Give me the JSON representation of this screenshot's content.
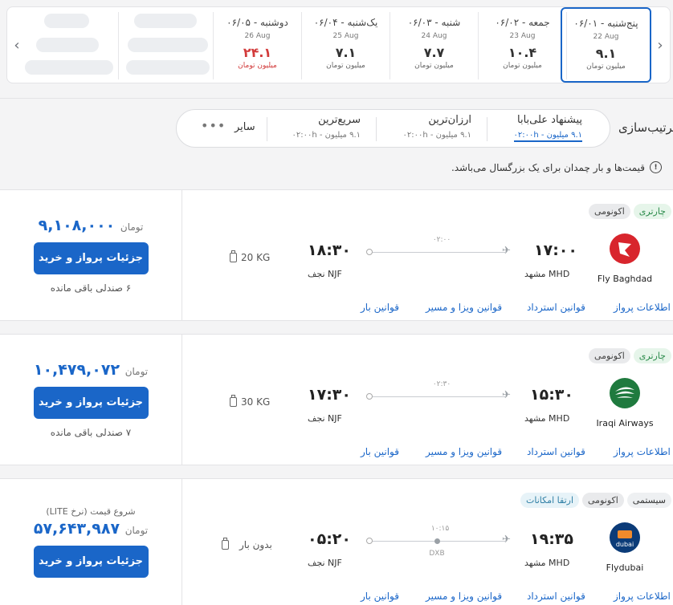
{
  "date_strip": {
    "days": [
      {
        "name": "پنج‌شنبه - ۰۶/۰۱",
        "greg": "22 Aug",
        "price": "۹.۱",
        "unit": "میلیون تومان",
        "selected": true
      },
      {
        "name": "جمعه - ۰۶/۰۲",
        "greg": "23 Aug",
        "price": "۱۰.۴",
        "unit": "میلیون تومان"
      },
      {
        "name": "شنبه - ۰۶/۰۳",
        "greg": "24 Aug",
        "price": "۷.۷",
        "unit": "میلیون تومان"
      },
      {
        "name": "یک‌شنبه - ۰۶/۰۴",
        "greg": "25 Aug",
        "price": "۷.۱",
        "unit": "میلیون تومان"
      },
      {
        "name": "دوشنبه - ۰۶/۰۵",
        "greg": "26 Aug",
        "price": "۲۴.۱",
        "unit": "میلیون تومان",
        "highlight": "#d23b3b"
      }
    ]
  },
  "sort": {
    "title": "ترتیب‌سازی",
    "options": [
      {
        "label": "پیشنهاد علی‌بابا",
        "sub": "۹.۱ میلیون - ۰۲:۰۰h"
      },
      {
        "label": "ارزان‌ترین",
        "sub": "۹.۱ میلیون - ۰۲:۰۰h"
      },
      {
        "label": "سریع‌ترین",
        "sub": "۹.۱ میلیون - ۰۲:۰۰h"
      }
    ],
    "other": "سایر",
    "more": "•••"
  },
  "note": "قیمت‌ها و بار چمدان برای یک بزرگسال می‌باشد.",
  "colors": {
    "accent": "#1a66c8",
    "danger": "#d23b3b"
  },
  "flights": [
    {
      "tags": [
        "چارتری",
        "اکونومی"
      ],
      "airline": "Fly Baghdad",
      "dep_time": "۱۷:۰۰",
      "dep_city": "مشهد MHD",
      "arr_time": "۱۸:۳۰",
      "arr_city": "نجف NJF",
      "duration": "۰۲:۰۰",
      "baggage": "20 KG",
      "price": "۹,۱۰۸,۰۰۰",
      "currency": "تومان",
      "button": "جزئیات پرواز و خرید",
      "seats": "۶ صندلی باقی مانده",
      "links": [
        "اطلاعات پرواز",
        "قوانین استرداد",
        "قوانین ویزا و مسیر",
        "قوانین بار"
      ]
    },
    {
      "tags": [
        "چارتری",
        "اکونومی"
      ],
      "airline": "Iraqi Airways",
      "dep_time": "۱۵:۳۰",
      "dep_city": "مشهد MHD",
      "arr_time": "۱۷:۳۰",
      "arr_city": "نجف NJF",
      "duration": "۰۲:۳۰",
      "baggage": "30 KG",
      "price": "۱۰,۴۷۹,۰۷۲",
      "currency": "تومان",
      "button": "جزئیات پرواز و خرید",
      "seats": "۷ صندلی باقی مانده",
      "links": [
        "اطلاعات پرواز",
        "قوانین استرداد",
        "قوانین ویزا و مسیر",
        "قوانین بار"
      ]
    },
    {
      "tags": [
        "سیستمی",
        "اکونومی",
        "ارتقا امکانات"
      ],
      "airline": "Flydubai",
      "dep_time": "۱۹:۳۵",
      "dep_city": "مشهد MHD",
      "arr_time": "۰۵:۲۰",
      "arr_city": "نجف NJF",
      "duration": "۱۰:۱۵",
      "stop": "DXB",
      "baggage": "بدون بار",
      "price_note": "شروع قیمت (نرخ LITE)",
      "price": "۵۷,۶۴۳,۹۸۷",
      "currency": "تومان",
      "button": "جزئیات پرواز و خرید",
      "links": [
        "اطلاعات پرواز",
        "قوانین استرداد",
        "قوانین ویزا و مسیر",
        "قوانین بار"
      ]
    }
  ]
}
